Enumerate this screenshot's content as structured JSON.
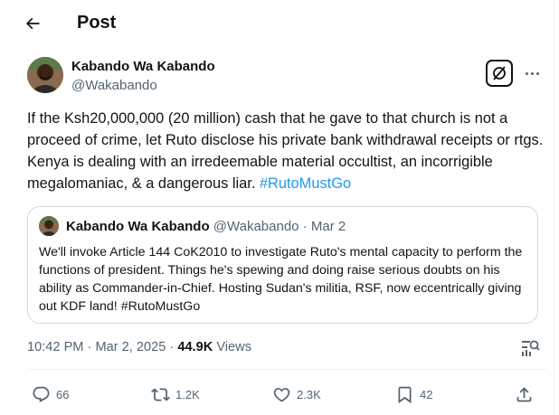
{
  "header": {
    "title": "Post"
  },
  "author": {
    "name": "Kabando Wa Kabando",
    "handle": "@Wakabando"
  },
  "post": {
    "text": "If the Ksh20,000,000 (20 million) cash that he gave to that church is not a proceed of crime, let Ruto disclose his private bank withdrawal receipts or rtgs. Kenya is dealing with an irredeemable material occultist, an incorrigible megalomaniac, & a dangerous liar. ",
    "hashtag": "#RutoMustGo"
  },
  "quote": {
    "name": "Kabando Wa Kabando",
    "handle": "@Wakabando",
    "separator": " · ",
    "date": "Mar 2",
    "text": "We'll invoke Article 144 CoK2010 to investigate Ruto's mental capacity to perform the functions of president. Things he's spewing and doing raise serious doubts on his ability as Commander-in-Chief. Hosting Sudan's militia, RSF, now eccentrically giving out KDF land! #RutoMustGo"
  },
  "meta": {
    "time": "10:42 PM",
    "dot": " · ",
    "date": "Mar 2, 2025",
    "separator": " · ",
    "views_count": "44.9K",
    "views_label": " Views"
  },
  "actions": {
    "replies": "66",
    "reposts": "1.2K",
    "likes": "2.3K",
    "bookmarks": "42"
  },
  "icons": {
    "back": "arrow-left-icon",
    "grok": "grok-icon",
    "more": "more-icon",
    "analytics": "analytics-icon",
    "reply": "reply-icon",
    "repost": "repost-icon",
    "like": "heart-icon",
    "bookmark": "bookmark-icon",
    "share": "share-icon"
  },
  "colors": {
    "text": "#0f1419",
    "secondary": "#536471",
    "link": "#1d9bf0",
    "border": "#cfd9de"
  }
}
